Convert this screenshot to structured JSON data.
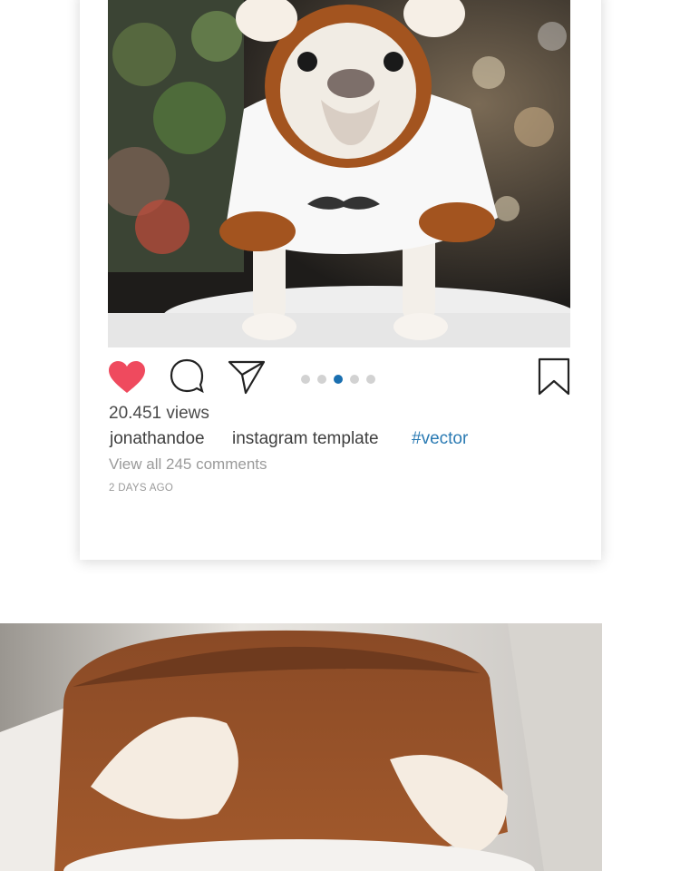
{
  "post": {
    "image_alt": "French bulldog wearing a white t-shirt with mustache and brown bear-ear hood",
    "views": "20.451 views",
    "username": "jonathandoe",
    "caption": "instagram template",
    "hashtag": "#vector",
    "comments_link": "View all 245 comments",
    "time_ago": "2 DAYS AGO",
    "carousel": {
      "count": 5,
      "active_index": 2
    },
    "liked": true,
    "colors": {
      "like": "#ef4a5e",
      "active_dot": "#1a6fb0",
      "hashtag": "#2a7ab3"
    }
  },
  "icons": {
    "like": "heart-icon",
    "comment": "speech-bubble-icon",
    "share": "paper-plane-icon",
    "save": "bookmark-icon"
  },
  "second_photo": {
    "image_alt": "Brown plush pet bed with cream-colored ears"
  }
}
